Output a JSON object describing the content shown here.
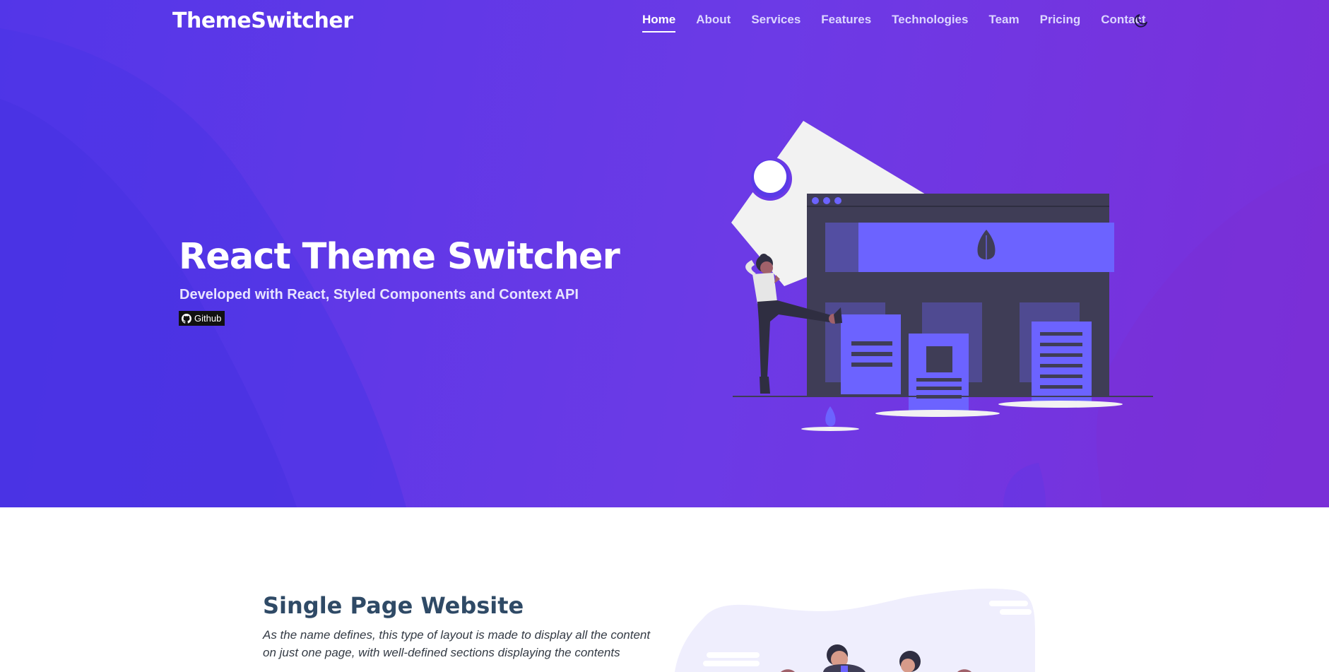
{
  "brand": "ThemeSwitcher",
  "nav": {
    "items": [
      {
        "label": "Home",
        "active": true
      },
      {
        "label": "About"
      },
      {
        "label": "Services"
      },
      {
        "label": "Features"
      },
      {
        "label": "Technologies"
      },
      {
        "label": "Team"
      },
      {
        "label": "Pricing"
      },
      {
        "label": "Contact"
      }
    ],
    "theme_toggle_icon": "moon-icon"
  },
  "hero": {
    "title": "React Theme Switcher",
    "subtitle": "Developed with React, Styled Components and Context API",
    "github_label": "Github",
    "github_icon": "github-icon",
    "illustration": "website-builder-illustration"
  },
  "about": {
    "title": "Single Page Website",
    "description": "As the name defines, this type of layout is made to display all the content on just one page, with well-defined sections displaying the contents",
    "illustration": "team-illustration"
  },
  "colors": {
    "hero_start": "#5336e8",
    "hero_end": "#7b2fd9",
    "accent": "#6c63ff",
    "dark_panel": "#3f3d56",
    "heading": "#2f4a66"
  }
}
